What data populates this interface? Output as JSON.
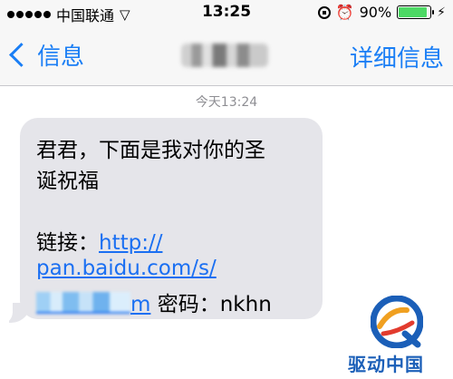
{
  "status_bar": {
    "carrier": "中国联通",
    "time": "13:25",
    "battery": "90%",
    "battery_level": 0.9,
    "icons": [
      "signal-dots-icon",
      "wifi-icon",
      "rotation-lock-icon",
      "alarm-icon",
      "battery-icon",
      "charging-bolt-icon"
    ]
  },
  "nav": {
    "back_label": "信息",
    "details_label": "详细信息"
  },
  "conversation": {
    "timestamp": "今天13:24",
    "message": {
      "line1": "君君，下面是我对你的圣",
      "line2": "诞祝福",
      "link_prefix": "链接：",
      "link_part1": "http://",
      "link_part2": "pan.baidu.com/s/",
      "link_part3_end": "m",
      "password_label": " 密码：nkhn"
    }
  },
  "watermark": {
    "text": "驱动中国"
  },
  "colors": {
    "ios_blue": "#1a7ef5",
    "bubble_gray": "#e5e5ea",
    "battery_green": "#4cd964",
    "watermark_blue": "#1b5fb8"
  }
}
